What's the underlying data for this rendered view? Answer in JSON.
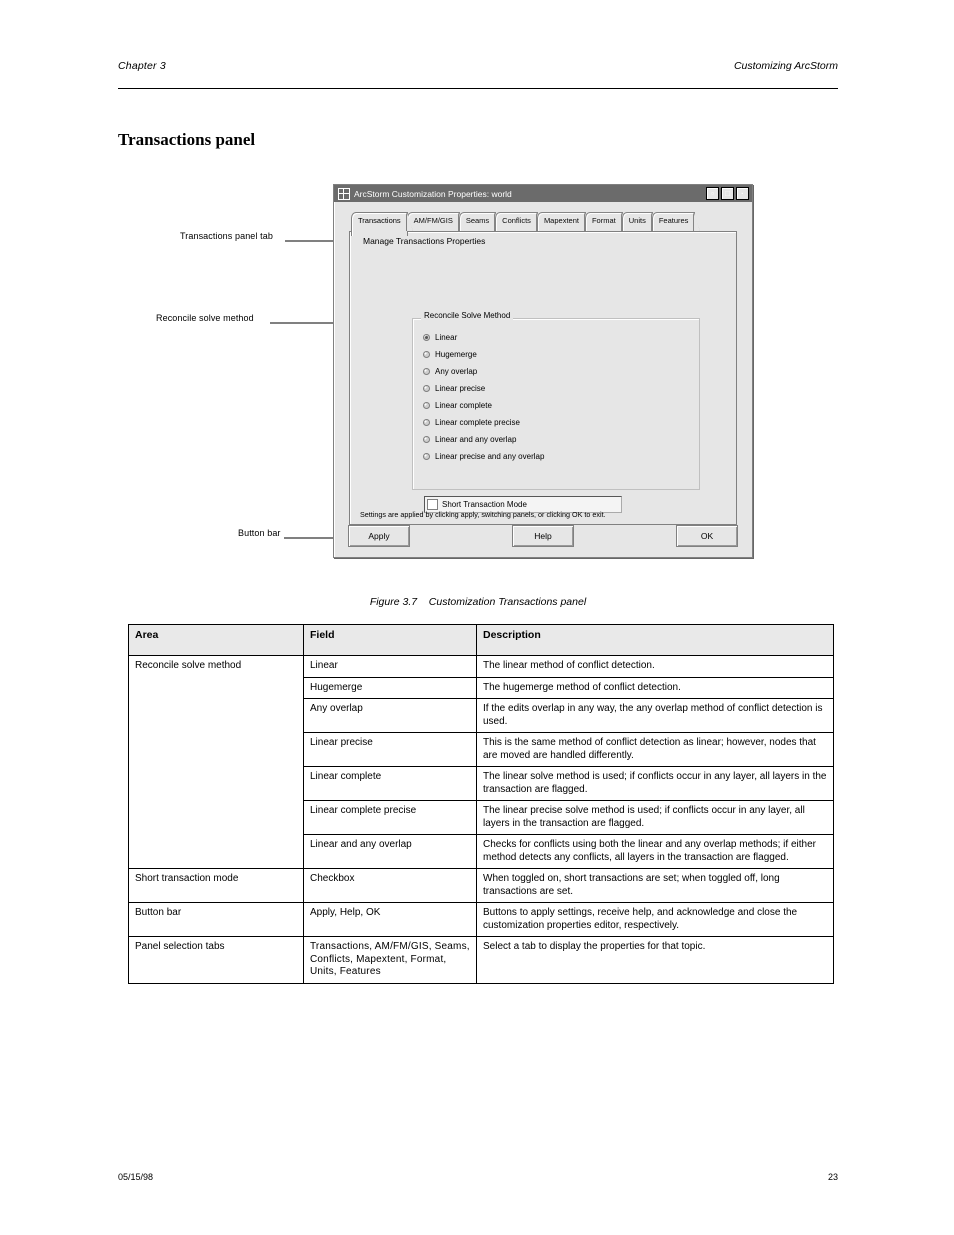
{
  "header": {
    "right_italic": "Customizing ArcStorm",
    "left_italic": "Chapter 3"
  },
  "section_heading": "Transactions panel",
  "callouts": {
    "trans_panel_tab": "Transactions panel tab",
    "solve_method": "Reconcile solve method",
    "btn_bar": "Button bar"
  },
  "window": {
    "title": "ArcStorm Customization Properties: world",
    "tabs": [
      "Transactions",
      "AM/FM/GIS",
      "Seams",
      "Conflicts",
      "Mapextent",
      "Format",
      "Units",
      "Features"
    ],
    "active_tab_index": 0,
    "panel_title": "Manage Transactions Properties",
    "group_legend": "Reconcile Solve Method",
    "radios": [
      {
        "label": "Linear",
        "checked": true
      },
      {
        "label": "Hugemerge",
        "checked": false
      },
      {
        "label": "Any overlap",
        "checked": false
      },
      {
        "label": "Linear precise",
        "checked": false
      },
      {
        "label": "Linear complete",
        "checked": false
      },
      {
        "label": "Linear complete precise",
        "checked": false
      },
      {
        "label": "Linear and any overlap",
        "checked": false
      },
      {
        "label": "Linear precise and any overlap",
        "checked": false
      }
    ],
    "checkbox_label": "Short Transaction Mode",
    "footnote": "Settings are applied by clicking apply, switching panels, or clicking OK to exit.",
    "buttons": [
      "Apply",
      "",
      "",
      "Help",
      "",
      "OK"
    ]
  },
  "figure": {
    "number": "Figure 3.7",
    "caption": "Customization Transactions panel"
  },
  "table": {
    "headers": [
      "Area",
      "Field",
      "Description"
    ],
    "rows": [
      {
        "area": "Reconcile solve method",
        "field": "Linear",
        "desc": "The linear method of conflict detection."
      },
      {
        "area": "",
        "field": "Hugemerge",
        "desc": "The hugemerge method of conflict detection."
      },
      {
        "area": "",
        "field": "Any overlap",
        "desc": "If the edits overlap in any way, the any overlap method of conflict detection is used."
      },
      {
        "area": "",
        "field": "Linear precise",
        "desc": "This is the same method of conflict detection as linear; however, nodes that are moved are handled differently."
      },
      {
        "area": "",
        "field": "Linear complete",
        "desc": "The linear solve method is used; if conflicts occur in any layer, all layers in the transaction are flagged."
      },
      {
        "area": "",
        "field": "Linear complete precise",
        "desc": "The linear precise solve method is used; if conflicts occur in any layer, all layers in the transaction are flagged."
      },
      {
        "area": "",
        "field": "Linear and any overlap",
        "desc": "Checks for conflicts using both the linear and any overlap methods; if either method detects any conflicts, all layers in the transaction are flagged."
      },
      {
        "area": "Short transaction mode",
        "field": "Checkbox",
        "desc": "When toggled on, short transactions are set; when toggled off, long transactions are set."
      },
      {
        "area": "Button bar",
        "field": "Apply, Help, OK",
        "desc": "Buttons to apply settings, receive help, and acknowledge and close the customization properties editor, respectively."
      },
      {
        "area": "Panel selection tabs",
        "field": "Transactions, AM/FM/GIS, Seams, Conflicts, Mapextent, Format, Units, Features",
        "desc": "Select a tab to display the properties for that topic."
      }
    ]
  },
  "footer": {
    "left": "05/15/98",
    "right": "23"
  }
}
